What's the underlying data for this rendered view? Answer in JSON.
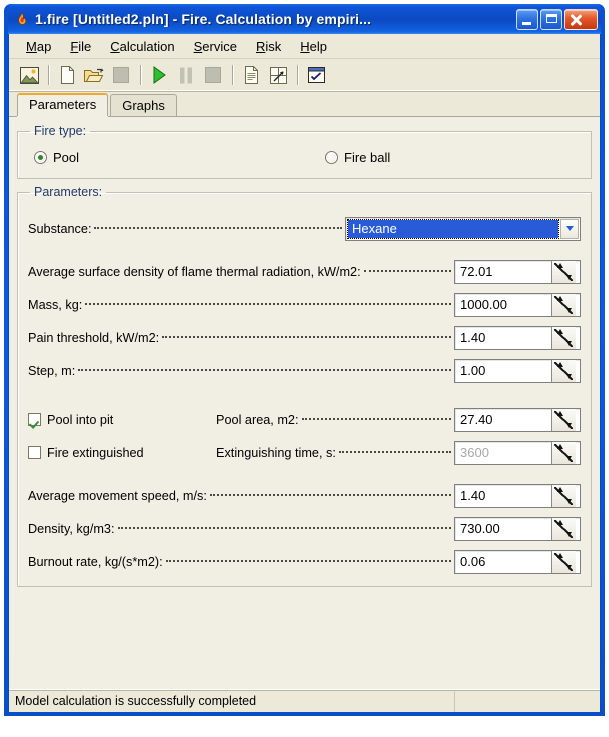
{
  "window": {
    "title": "1.fire [Untitled2.pln] - Fire. Calculation by empiri...",
    "icon": "flame-icon",
    "minimize_label": "Minimize",
    "maximize_label": "Maximize",
    "close_label": "Close"
  },
  "menu": {
    "items": [
      {
        "label": "Map",
        "accel": "M"
      },
      {
        "label": "File",
        "accel": "F"
      },
      {
        "label": "Calculation",
        "accel": "C"
      },
      {
        "label": "Service",
        "accel": "S"
      },
      {
        "label": "Risk",
        "accel": "R"
      },
      {
        "label": "Help",
        "accel": "H"
      }
    ]
  },
  "toolbar": {
    "buttons": [
      {
        "name": "map-view-icon",
        "enabled": true
      },
      {
        "name": "new-document-icon",
        "enabled": true
      },
      {
        "name": "open-folder-icon",
        "enabled": true
      },
      {
        "name": "save-icon",
        "enabled": false
      },
      {
        "name": "run-calculation-icon",
        "enabled": true
      },
      {
        "name": "pause-icon",
        "enabled": false
      },
      {
        "name": "stop-icon",
        "enabled": false
      },
      {
        "name": "report-icon",
        "enabled": true
      },
      {
        "name": "export-chart-icon",
        "enabled": true
      },
      {
        "name": "checklist-icon",
        "enabled": true
      }
    ]
  },
  "tabs": [
    {
      "label": "Parameters",
      "active": true
    },
    {
      "label": "Graphs",
      "active": false
    }
  ],
  "fire_type": {
    "legend": "Fire type:",
    "options": [
      {
        "label": "Pool",
        "selected": true
      },
      {
        "label": "Fire ball",
        "selected": false
      }
    ]
  },
  "parameters": {
    "legend": "Parameters:",
    "substance": {
      "label": "Substance:",
      "value": "Hexane"
    },
    "rows": [
      {
        "label": "Average surface density of flame thermal radiation, kW/m2:",
        "value": "72.01",
        "disabled": false
      },
      {
        "label": "Mass, kg:",
        "value": "1000.00",
        "disabled": false
      },
      {
        "label": "Pain threshold, kW/m2:",
        "value": "1.40",
        "disabled": false
      },
      {
        "label": "Step, m:",
        "value": "1.00",
        "disabled": false
      }
    ],
    "checkbox_rows": [
      {
        "checkbox_label": "Pool into pit",
        "checked": true,
        "label": "Pool area, m2:",
        "value": "27.40",
        "disabled": false
      },
      {
        "checkbox_label": "Fire extinguished",
        "checked": false,
        "label": "Extinguishing time, s:",
        "value": "3600",
        "disabled": true
      }
    ],
    "rows2": [
      {
        "label": "Average movement speed, m/s:",
        "value": "1.40",
        "disabled": false
      },
      {
        "label": "Density, kg/m3:",
        "value": "730.00",
        "disabled": false
      },
      {
        "label": "Burnout rate, kg/(s*m2):",
        "value": "0.06",
        "disabled": false
      }
    ]
  },
  "statusbar": {
    "message": "Model calculation is successfully completed",
    "secondary": ""
  },
  "colors": {
    "titlebar": "#0a49c0",
    "close_button": "#c4380f",
    "selection": "#2a5bd7",
    "face": "#ece9d8",
    "page": "#f1efe4",
    "legend_text": "#223a66"
  }
}
